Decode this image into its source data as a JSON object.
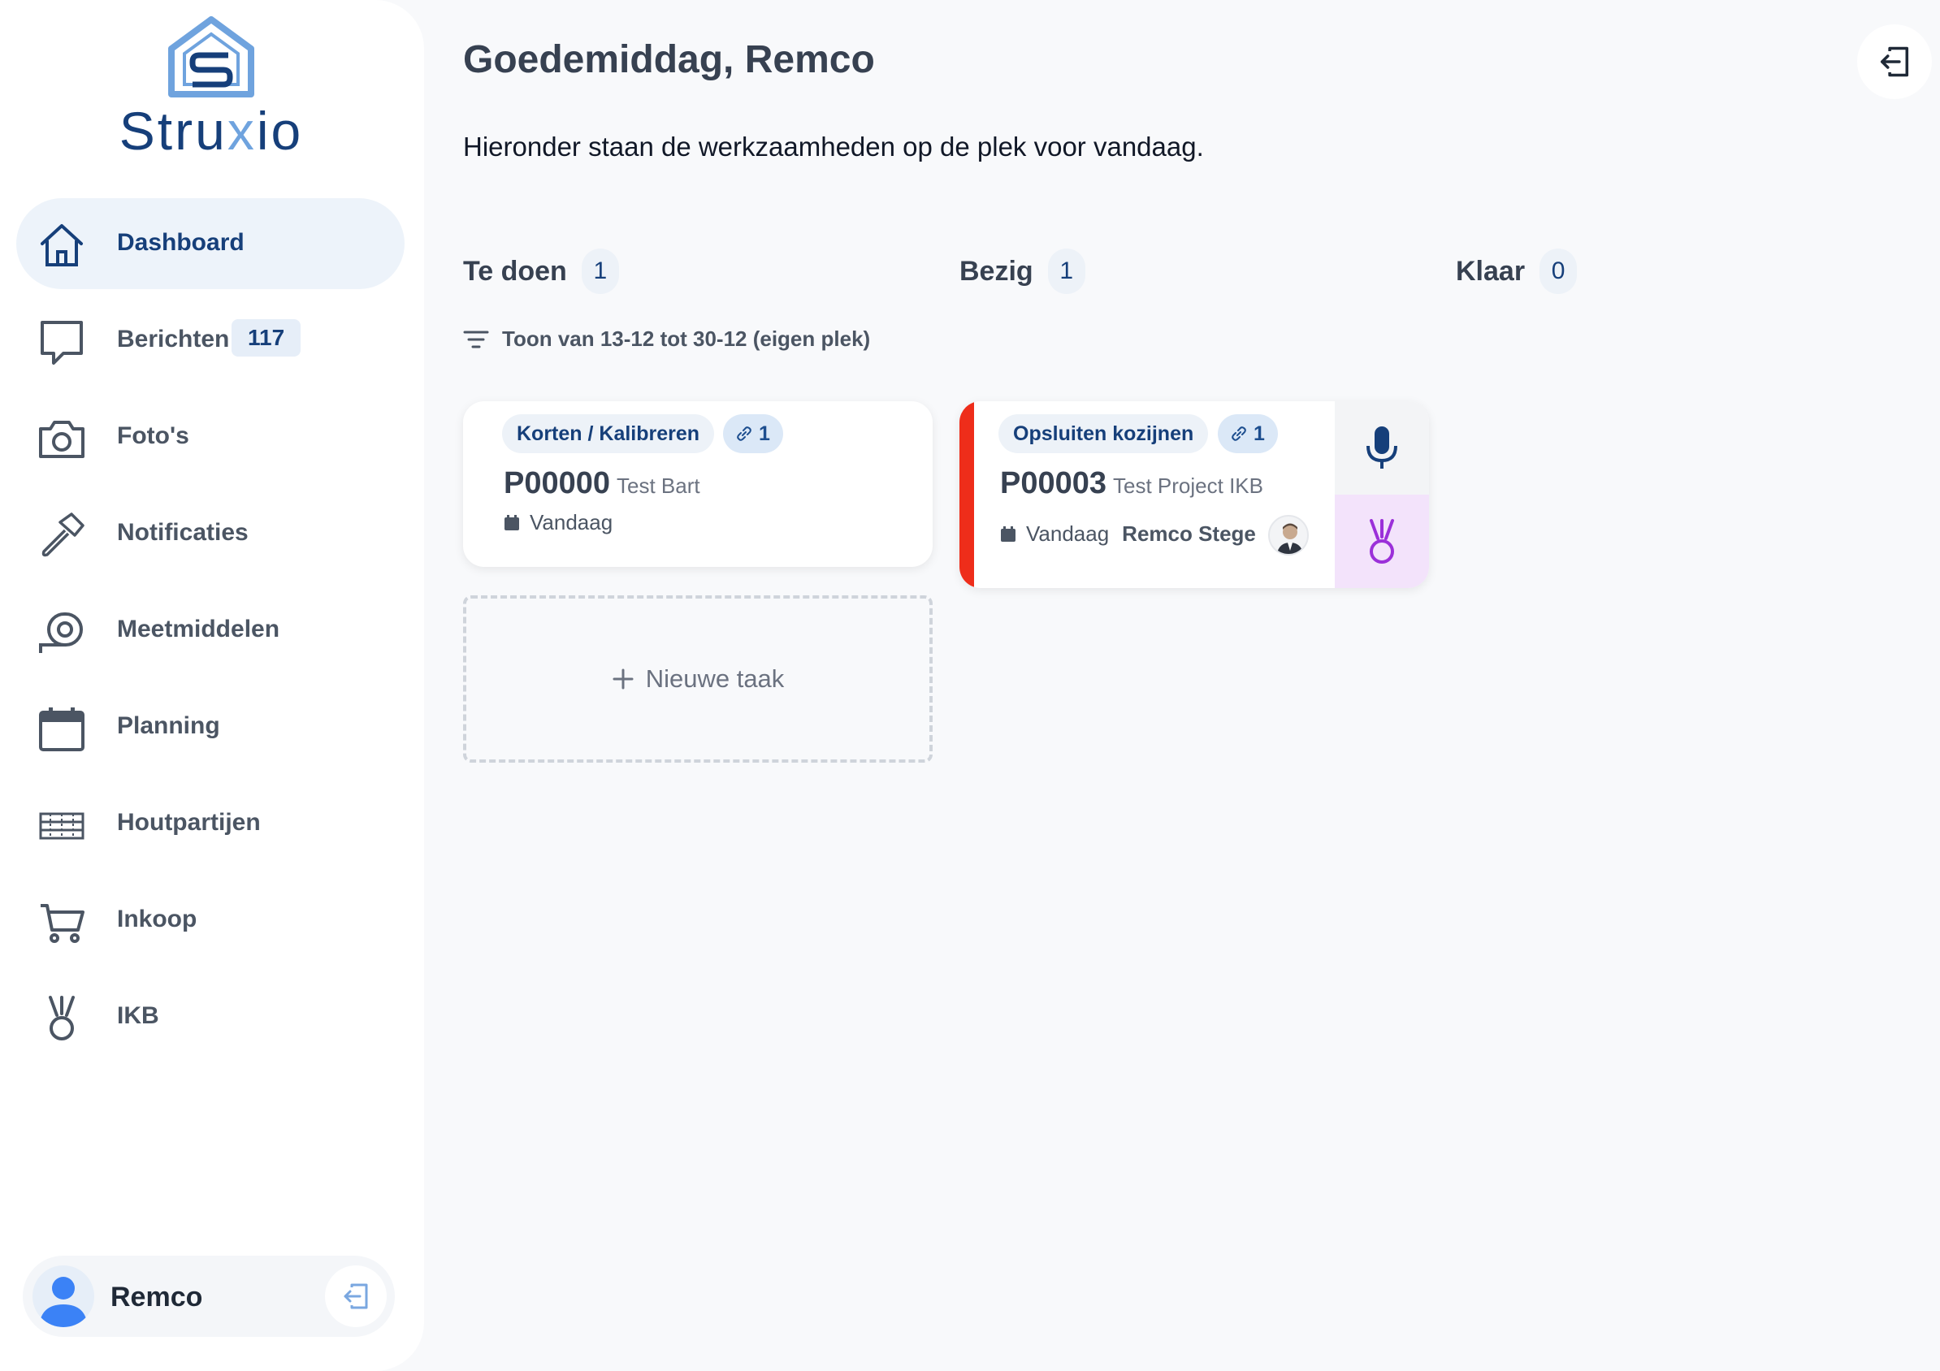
{
  "app": {
    "name_prefix": "Stru",
    "name_x": "x",
    "name_suffix": "io"
  },
  "sidebar": {
    "items": [
      {
        "label": "Dashboard",
        "icon": "home-icon",
        "active": true
      },
      {
        "label": "Berichten",
        "icon": "message-icon",
        "badge": "117"
      },
      {
        "label": "Foto's",
        "icon": "camera-icon"
      },
      {
        "label": "Notificaties",
        "icon": "hammer-icon"
      },
      {
        "label": "Meetmiddelen",
        "icon": "tape-measure-icon"
      },
      {
        "label": "Planning",
        "icon": "calendar-icon"
      },
      {
        "label": "Houtpartijen",
        "icon": "wood-stack-icon"
      },
      {
        "label": "Inkoop",
        "icon": "cart-icon"
      },
      {
        "label": "IKB",
        "icon": "medal-icon"
      }
    ],
    "user": {
      "name": "Remco"
    }
  },
  "main": {
    "greeting": "Goedemiddag, Remco",
    "subtitle": "Hieronder staan de werkzaamheden op de plek voor vandaag.",
    "columns": [
      {
        "title": "Te doen",
        "count": "1"
      },
      {
        "title": "Bezig",
        "count": "1"
      },
      {
        "title": "Klaar",
        "count": "0"
      }
    ],
    "filter": "Toon van 13-12 tot 30-12 (eigen plek)",
    "cards": [
      {
        "tag": "Korten / Kalibreren",
        "links": "1",
        "code": "P00000",
        "project": "Test Bart",
        "date": "Vandaag"
      },
      {
        "tag": "Opsluiten kozijnen",
        "links": "1",
        "code": "P00003",
        "project": "Test Project IKB",
        "date": "Vandaag",
        "person": "Remco Stege"
      }
    ],
    "new_task": "Nieuwe taak"
  },
  "colors": {
    "brand": "#163f7a",
    "accent_light": "#6fa3de",
    "status_red": "#ee2d1a",
    "ikb_purple": "#9b30d9"
  }
}
